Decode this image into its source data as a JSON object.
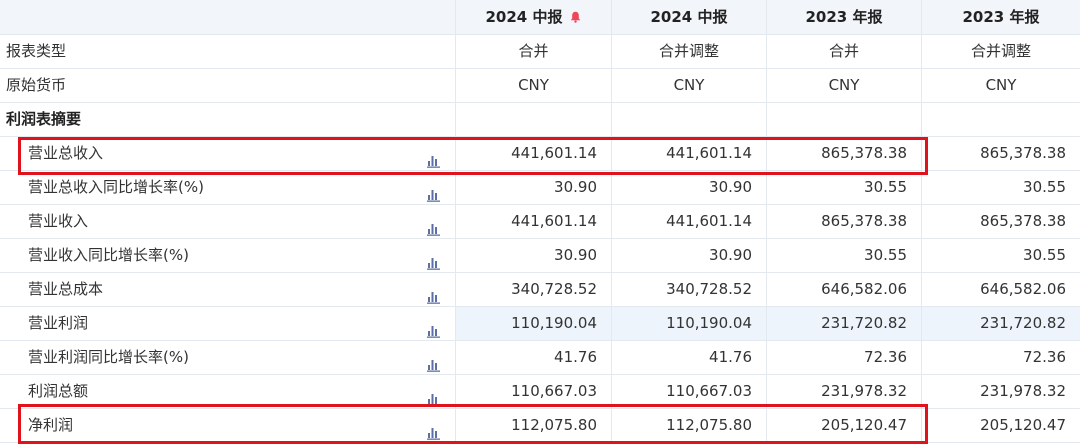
{
  "columns": [
    {
      "label": "2024 中报",
      "alert": true
    },
    {
      "label": "2024 中报",
      "alert": false
    },
    {
      "label": "2023 年报",
      "alert": false
    },
    {
      "label": "2023 年报",
      "alert": false
    }
  ],
  "meta_rows": [
    {
      "label": "报表类型",
      "values": [
        "合并",
        "合并调整",
        "合并",
        "合并调整"
      ]
    },
    {
      "label": "原始货币",
      "values": [
        "CNY",
        "CNY",
        "CNY",
        "CNY"
      ]
    }
  ],
  "section_title": "利润表摘要",
  "rows": [
    {
      "label": "营业总收入",
      "values": [
        "441,601.14",
        "441,601.14",
        "865,378.38",
        "865,378.38"
      ]
    },
    {
      "label": "营业总收入同比增长率(%)",
      "values": [
        "30.90",
        "30.90",
        "30.55",
        "30.55"
      ]
    },
    {
      "label": "营业收入",
      "values": [
        "441,601.14",
        "441,601.14",
        "865,378.38",
        "865,378.38"
      ]
    },
    {
      "label": "营业收入同比增长率(%)",
      "values": [
        "30.90",
        "30.90",
        "30.55",
        "30.55"
      ]
    },
    {
      "label": "营业总成本",
      "values": [
        "340,728.52",
        "340,728.52",
        "646,582.06",
        "646,582.06"
      ]
    },
    {
      "label": "营业利润",
      "values": [
        "110,190.04",
        "110,190.04",
        "231,720.82",
        "231,720.82"
      ],
      "highlighted": true
    },
    {
      "label": "营业利润同比增长率(%)",
      "values": [
        "41.76",
        "41.76",
        "72.36",
        "72.36"
      ]
    },
    {
      "label": "利润总额",
      "values": [
        "110,667.03",
        "110,667.03",
        "231,978.32",
        "231,978.32"
      ]
    },
    {
      "label": "净利润",
      "values": [
        "112,075.80",
        "112,075.80",
        "205,120.47",
        "205,120.47"
      ]
    }
  ],
  "icons": {
    "chart": "bar-chart-icon",
    "alert": "bell-icon"
  },
  "colors": {
    "header_bg": "#f2f5fa",
    "highlight_bg": "#eef4fc",
    "icon": "#5b6fa6",
    "alert": "#f0465a",
    "annotation_box": "#e0131d"
  }
}
